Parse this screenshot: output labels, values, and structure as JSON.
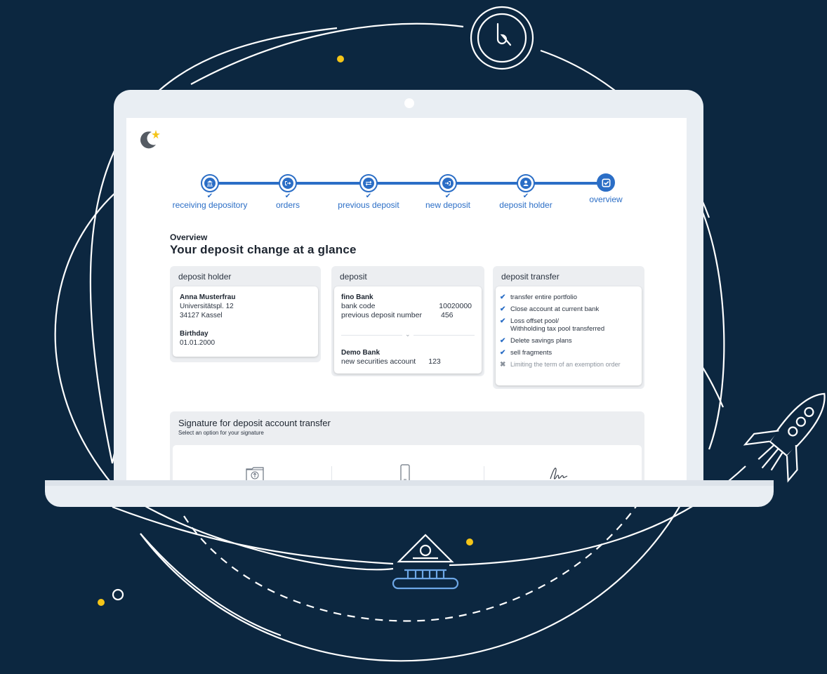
{
  "stepper": {
    "steps": [
      {
        "label": "receiving depository",
        "icon": "bank-icon",
        "done": true
      },
      {
        "label": "orders",
        "icon": "sign-out-icon",
        "done": true
      },
      {
        "label": "previous deposit",
        "icon": "exchange-icon",
        "done": true
      },
      {
        "label": "new deposit",
        "icon": "sign-in-icon",
        "done": true
      },
      {
        "label": "deposit holder",
        "icon": "user-icon",
        "done": true
      },
      {
        "label": "overview",
        "icon": "check-square-icon",
        "done": false
      }
    ]
  },
  "overview": {
    "label": "Overview",
    "title": "Your deposit change at a glance"
  },
  "holder": {
    "card_title": "deposit holder",
    "name": "Anna Musterfrau",
    "street": "Universitätspl. 12",
    "city": "34127 Kassel",
    "birthday_label": "Birthday",
    "birthday": "01.01.2000"
  },
  "deposit": {
    "card_title": "deposit",
    "old_bank": "fino Bank",
    "bank_code_label": "bank code",
    "bank_code": "10020000",
    "previous_label": "previous deposit number",
    "previous_number": "456",
    "new_bank": "Demo Bank",
    "new_label": "new securities account",
    "new_number": "123"
  },
  "transfer": {
    "card_title": "deposit transfer",
    "items": [
      {
        "text": "transfer entire portfolio",
        "checked": true
      },
      {
        "text": "Close account at current bank",
        "checked": true
      },
      {
        "text": "Loss offset pool/",
        "text2": "Withholding tax pool transferred",
        "checked": true
      },
      {
        "text": "Delete savings plans",
        "checked": true
      },
      {
        "text": "sell fragments",
        "checked": true
      },
      {
        "text": "Limiting the term of an exemption order",
        "checked": false
      }
    ]
  },
  "signature": {
    "title": "Signature for deposit account transfer",
    "subtitle": "Select an option for your signature",
    "options": [
      {
        "icon": "upload-folder-icon"
      },
      {
        "icon": "smartphone-icon"
      },
      {
        "icon": "handwriting-icon"
      }
    ]
  },
  "colors": {
    "background": "#0c2740",
    "accent": "#2b6ec6",
    "highlight": "#f5c518"
  }
}
